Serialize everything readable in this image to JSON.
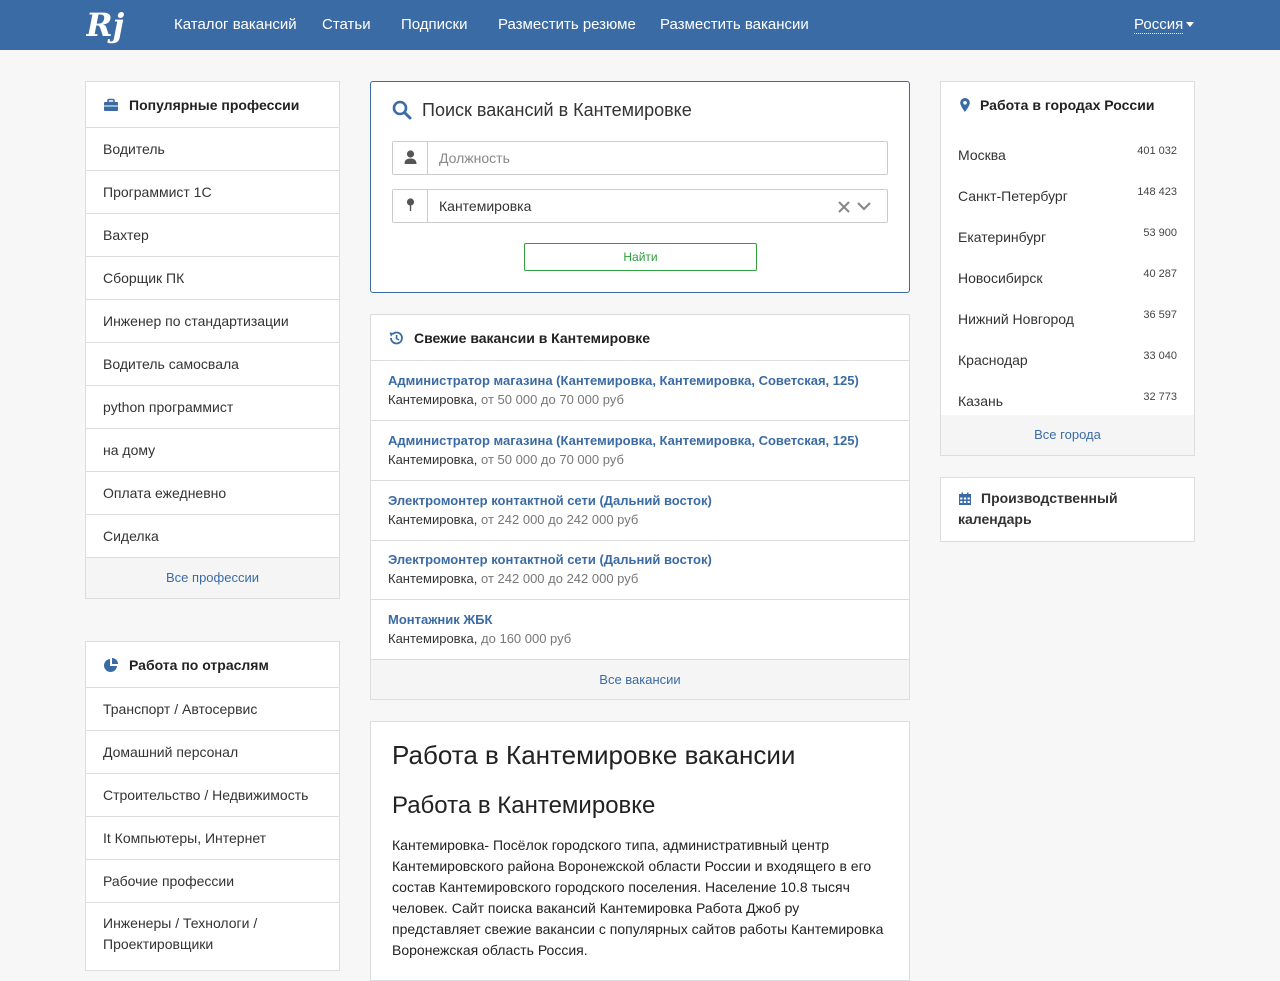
{
  "nav": {
    "logo_text": "Rj",
    "links": [
      "Каталог вакансий",
      "Статьи",
      "Подписки",
      "Разместить резюме",
      "Разместить вакансии"
    ],
    "country": "Россия"
  },
  "professions": {
    "title": "Популярные профессии",
    "items": [
      "Водитель",
      "Программист 1С",
      "Вахтер",
      "Сборщик ПК",
      "Инженер по стандартизации",
      "Водитель самосвала",
      "python программист",
      "на дому",
      "Оплата ежедневно",
      "Сиделка"
    ],
    "footer": "Все профессии"
  },
  "industries": {
    "title": "Работа по отраслям",
    "items": [
      "Транспорт / Автосервис",
      "Домашний персонал",
      "Строительство / Недвижимость",
      "It Компьютеры, Интернет",
      "Рабочие профессии",
      "Инженеры / Технологи / Проектировщики"
    ]
  },
  "search": {
    "title": "Поиск вакансий в Кантемировке",
    "position_placeholder": "Должность",
    "city_value": "Кантемировка",
    "button": "Найти"
  },
  "fresh": {
    "title": "Свежие вакансии в Кантемировке",
    "items": [
      {
        "title": "Администратор магазина (Кантемировка, Кантемировка, Советская, 125)",
        "city": "Кантемировка,",
        "salary": "от 50 000 до 70 000 руб"
      },
      {
        "title": "Администратор магазина (Кантемировка, Кантемировка, Советская, 125)",
        "city": "Кантемировка,",
        "salary": "от 50 000 до 70 000 руб"
      },
      {
        "title": "Электромонтер контактной сети (Дальний восток)",
        "city": "Кантемировка,",
        "salary": "от 242 000 до 242 000 руб"
      },
      {
        "title": "Электромонтер контактной сети (Дальний восток)",
        "city": "Кантемировка,",
        "salary": "от 242 000 до 242 000 руб"
      },
      {
        "title": "Монтажник ЖБК",
        "city": "Кантемировка,",
        "salary": "до 160 000 руб"
      }
    ],
    "footer": "Все вакансии"
  },
  "article": {
    "h1": "Работа в Кантемировке вакансии",
    "h2": "Работа в Кантемировке",
    "text": "Кантемировка- Посёлок городского типа, административный центр Кантемировского района Воронежской области России и входящего в его состав Кантемировского городского поселения. Население 10.8 тысяч человек. Сайт поиска вакансий Кантемировка Работа Джоб ру представляет свежие вакансии с популярных сайтов работы Кантемировка Воронежская область Россия."
  },
  "cities": {
    "title": "Работа в городах России",
    "items": [
      {
        "name": "Москва",
        "count": "401 032"
      },
      {
        "name": "Санкт-Петербург",
        "count": "148 423"
      },
      {
        "name": "Екатеринбург",
        "count": "53 900"
      },
      {
        "name": "Новосибирск",
        "count": "40 287"
      },
      {
        "name": "Нижний Новгород",
        "count": "36 597"
      },
      {
        "name": "Краснодар",
        "count": "33 040"
      },
      {
        "name": "Казань",
        "count": "32 773"
      }
    ],
    "footer": "Все города"
  },
  "calendar": {
    "title": "Производственный календарь"
  },
  "colors": {
    "brand": "#3b6ba5",
    "success": "#2e9e3e"
  },
  "icons": [
    "briefcase-icon",
    "pie-chart-icon",
    "search-icon",
    "user-icon",
    "map-marker-icon",
    "history-icon",
    "calendar-icon",
    "clear-icon",
    "chevron-down-icon"
  ]
}
